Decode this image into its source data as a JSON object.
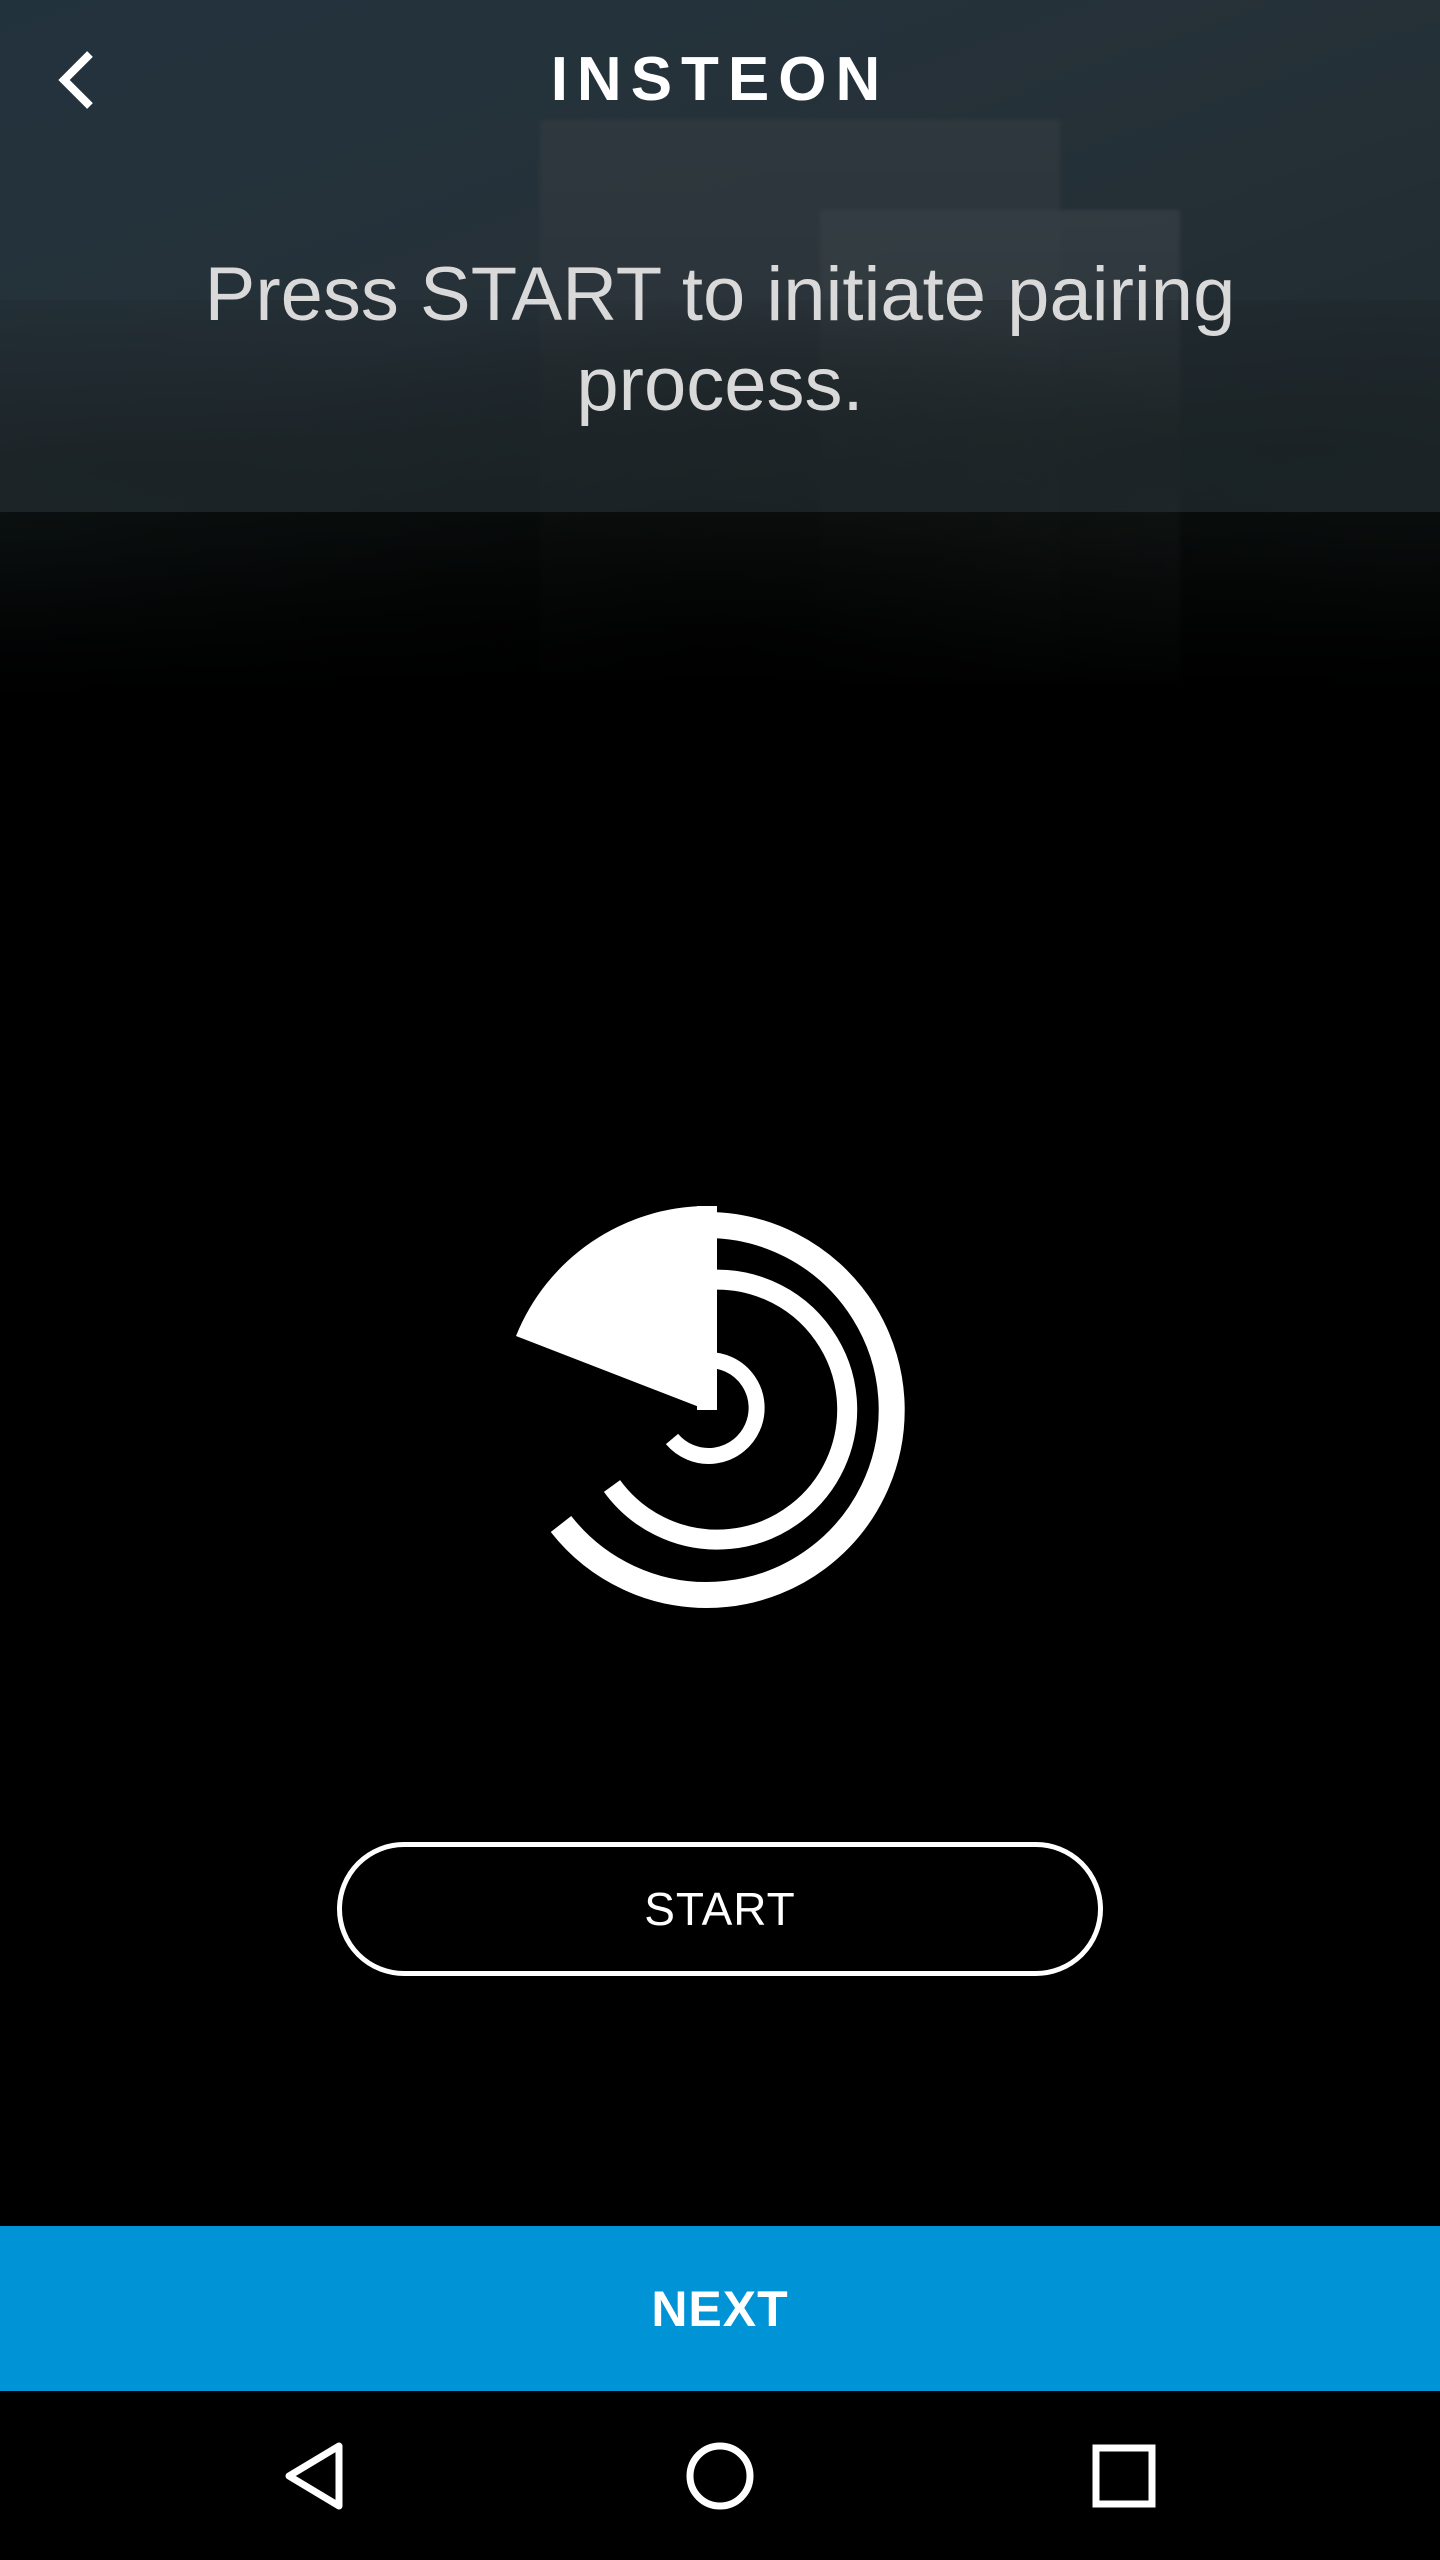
{
  "app": {
    "brand": "INSTEON"
  },
  "topbar": {
    "back_icon": "chevron-left-icon"
  },
  "main": {
    "instruction": "Press START to initiate pairing process.",
    "graphic_icon": "pairing-radar-icon",
    "start_label": "START"
  },
  "footer": {
    "next_label": "NEXT",
    "accent_color": "#0094d6"
  },
  "system_nav": {
    "icons": [
      "nav-back-icon",
      "nav-home-icon",
      "nav-recents-icon"
    ]
  }
}
